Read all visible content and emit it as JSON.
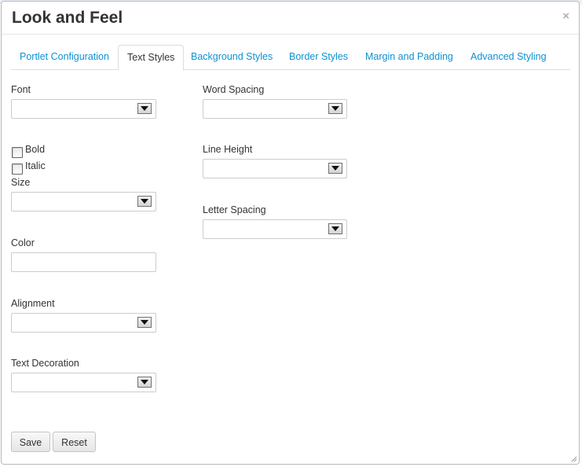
{
  "dialog": {
    "title": "Look and Feel",
    "close_glyph": "×"
  },
  "tabs": [
    {
      "label": "Portlet Configuration"
    },
    {
      "label": "Text Styles",
      "active": true
    },
    {
      "label": "Background Styles"
    },
    {
      "label": "Border Styles"
    },
    {
      "label": "Margin and Padding"
    },
    {
      "label": "Advanced Styling"
    }
  ],
  "form": {
    "font": {
      "label": "Font",
      "value": ""
    },
    "bold": {
      "label": "Bold",
      "checked": false
    },
    "italic": {
      "label": "Italic",
      "checked": false
    },
    "size": {
      "label": "Size",
      "value": ""
    },
    "color": {
      "label": "Color",
      "value": ""
    },
    "alignment": {
      "label": "Alignment",
      "value": ""
    },
    "text_decoration": {
      "label": "Text Decoration",
      "value": ""
    },
    "word_spacing": {
      "label": "Word Spacing",
      "value": ""
    },
    "line_height": {
      "label": "Line Height",
      "value": ""
    },
    "letter_spacing": {
      "label": "Letter Spacing",
      "value": ""
    }
  },
  "buttons": {
    "save": "Save",
    "reset": "Reset"
  },
  "colors": {
    "link": "#0e90d2",
    "text": "#333333",
    "border": "#cccccc"
  },
  "icons": [
    "close-icon",
    "dropdown-arrow-icon",
    "checkbox",
    "resize-grip-icon"
  ]
}
